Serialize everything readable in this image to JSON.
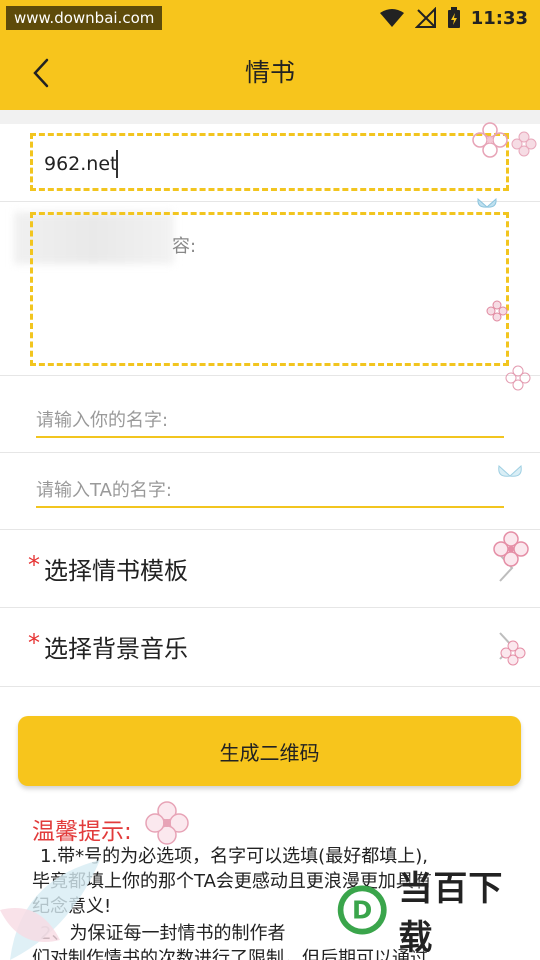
{
  "status_bar": {
    "watermark": "www.downbai.com",
    "time": "11:33"
  },
  "header": {
    "title": "情书"
  },
  "form": {
    "title_value": "962.net",
    "content_label": "容:",
    "your_name_placeholder": "请输入你的名字:",
    "ta_name_placeholder": "请输入TA的名字:",
    "template_required_mark": "*",
    "template_label": "选择情书模板",
    "music_required_mark": "*",
    "music_label": "选择背景音乐"
  },
  "actions": {
    "generate_label": "生成二维码"
  },
  "tips": {
    "title": "温馨提示:",
    "line1": "1.带*号的为必选项，名字可以选填(最好都填上),",
    "line2": "毕竟都填上你的那个TA会更感动且更浪漫更加具有",
    "line3": "纪念意义!",
    "line4": "2、为保证每一封情书的制作者",
    "line5": "们对制作情书的次数进行了限制，但后期可以通过"
  },
  "brand": {
    "logo_letter": "D",
    "name": "当百下载"
  },
  "colors": {
    "accent": "#f7c51c",
    "required": "#e63232",
    "tips_title": "#e23b3b"
  }
}
